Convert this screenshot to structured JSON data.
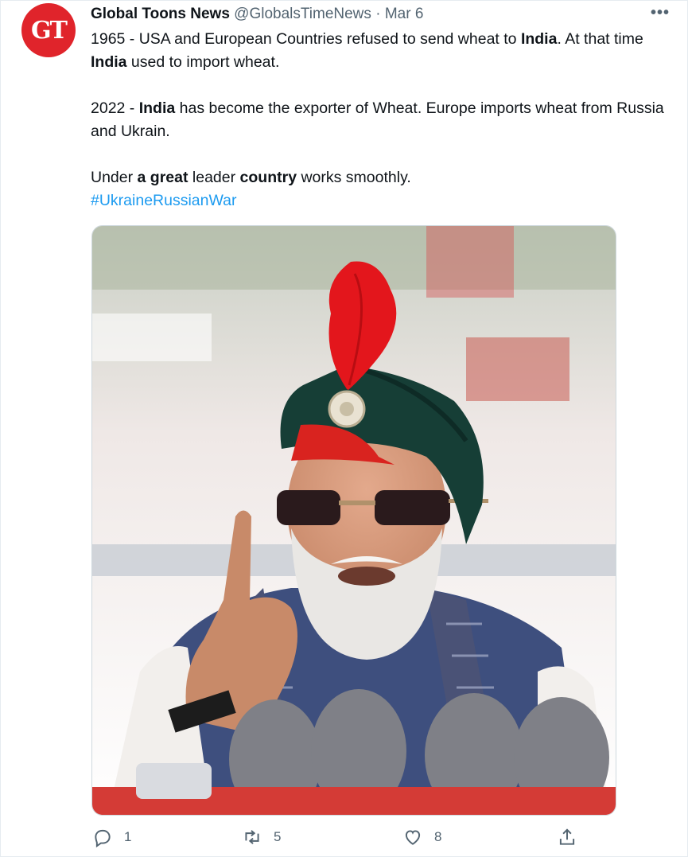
{
  "author": {
    "avatar_text": "GT",
    "name": "Global Toons News",
    "handle": "@GlobalsTimeNews",
    "separator": "·",
    "date": "Mar 6"
  },
  "more_label": "•••",
  "tweet": {
    "p1_a": "1965 - USA and European Countries refused to send wheat to ",
    "p1_b": "India",
    "p1_c": ". At that time ",
    "p1_d": "India",
    "p1_e": " used to import wheat.",
    "p2_a": "2022 - ",
    "p2_b": "India",
    "p2_c": " has become the exporter of Wheat. Europe imports wheat from Russia and Ukrain.",
    "p3_a": "Under ",
    "p3_b": "a great",
    "p3_c": " leader ",
    "p3_d": "country",
    "p3_e": " works smoothly.",
    "hashtag": "#UkraineRussianWar"
  },
  "actions": {
    "reply_count": "1",
    "retweet_count": "5",
    "like_count": "8"
  },
  "colors": {
    "avatar_bg": "#e0242b",
    "hashtag": "#1d9bf0",
    "muted": "#536471"
  },
  "icons": [
    "more-icon",
    "reply-icon",
    "retweet-icon",
    "like-icon",
    "share-icon"
  ]
}
